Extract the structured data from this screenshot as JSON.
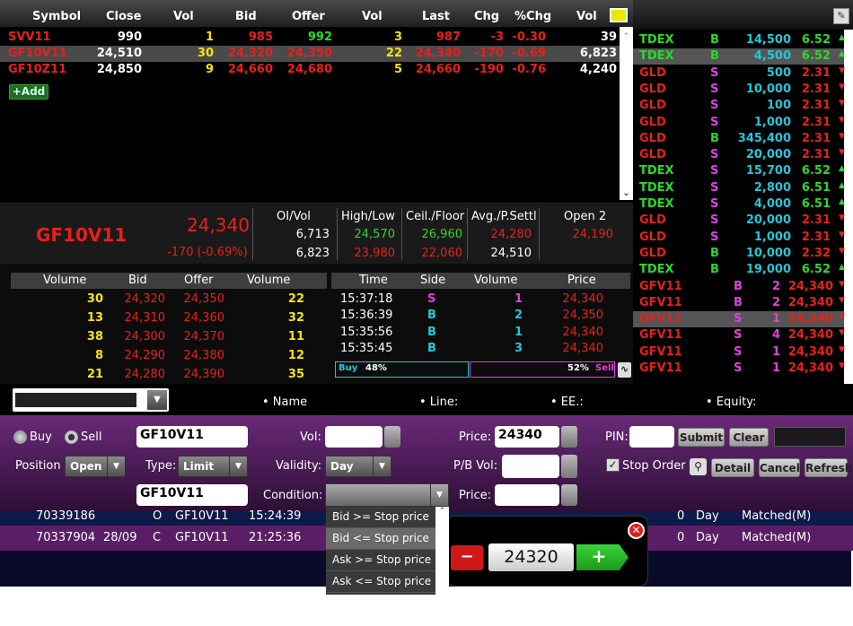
{
  "watchlist": {
    "headers": [
      "Symbol",
      "Close",
      "Vol",
      "Bid",
      "Offer",
      "Vol",
      "Last",
      "Chg",
      "%Chg",
      "Vol"
    ],
    "rows": [
      {
        "symbol": "SVV11",
        "close": "990",
        "bidvol": "1",
        "bid": "985",
        "offer": "992",
        "offervol": "3",
        "last": "987",
        "chg": "-3",
        "pchg": "-0.30",
        "vol": "39"
      },
      {
        "symbol": "GF10V11",
        "close": "24,510",
        "bidvol": "30",
        "bid": "24,320",
        "offer": "24,350",
        "offervol": "22",
        "last": "24,340",
        "chg": "-170",
        "pchg": "-0.69",
        "vol": "6,823"
      },
      {
        "symbol": "GF10Z11",
        "close": "24,850",
        "bidvol": "9",
        "bid": "24,660",
        "offer": "24,680",
        "offervol": "5",
        "last": "24,660",
        "chg": "-190",
        "pchg": "-0.76",
        "vol": "4,240"
      }
    ],
    "add_label": "+Add"
  },
  "ticker": [
    {
      "sym": "TDEX",
      "side": "B",
      "vol": "14,500",
      "price": "6.52",
      "dir": "up",
      "c": "g"
    },
    {
      "sym": "TDEX",
      "side": "B",
      "vol": "4,500",
      "price": "6.52",
      "dir": "up",
      "c": "g"
    },
    {
      "sym": "GLD",
      "side": "S",
      "vol": "500",
      "price": "2.31",
      "dir": "down",
      "c": "rd"
    },
    {
      "sym": "GLD",
      "side": "S",
      "vol": "10,000",
      "price": "2.31",
      "dir": "down",
      "c": "rd"
    },
    {
      "sym": "GLD",
      "side": "S",
      "vol": "100",
      "price": "2.31",
      "dir": "down",
      "c": "rd"
    },
    {
      "sym": "GLD",
      "side": "S",
      "vol": "1,000",
      "price": "2.31",
      "dir": "down",
      "c": "rd"
    },
    {
      "sym": "GLD",
      "side": "B",
      "vol": "345,400",
      "price": "2.31",
      "dir": "down",
      "c": "rd"
    },
    {
      "sym": "GLD",
      "side": "S",
      "vol": "20,000",
      "price": "2.31",
      "dir": "down",
      "c": "rd"
    },
    {
      "sym": "TDEX",
      "side": "S",
      "vol": "15,700",
      "price": "6.52",
      "dir": "up",
      "c": "g"
    },
    {
      "sym": "TDEX",
      "side": "S",
      "vol": "2,800",
      "price": "6.51",
      "dir": "up",
      "c": "g"
    },
    {
      "sym": "TDEX",
      "side": "S",
      "vol": "4,000",
      "price": "6.51",
      "dir": "up",
      "c": "g"
    },
    {
      "sym": "GLD",
      "side": "S",
      "vol": "20,000",
      "price": "2.31",
      "dir": "down",
      "c": "rd"
    },
    {
      "sym": "GLD",
      "side": "S",
      "vol": "1,000",
      "price": "2.31",
      "dir": "down",
      "c": "rd"
    },
    {
      "sym": "GLD",
      "side": "B",
      "vol": "10,000",
      "price": "2.32",
      "dir": "down",
      "c": "rd"
    },
    {
      "sym": "TDEX",
      "side": "B",
      "vol": "19,000",
      "price": "6.52",
      "dir": "up",
      "c": "g"
    },
    {
      "sym": "GFV11",
      "side": "B",
      "vol": "2",
      "price": "24,340",
      "dir": "down",
      "c": "rd"
    },
    {
      "sym": "GFV11",
      "side": "B",
      "vol": "2",
      "price": "24,340",
      "dir": "down",
      "c": "rd"
    },
    {
      "sym": "GFV11",
      "side": "S",
      "vol": "1",
      "price": "24,340",
      "dir": "down",
      "c": "rd"
    },
    {
      "sym": "GFV11",
      "side": "S",
      "vol": "4",
      "price": "24,340",
      "dir": "down",
      "c": "rd"
    },
    {
      "sym": "GFV11",
      "side": "S",
      "vol": "1",
      "price": "24,340",
      "dir": "down",
      "c": "rd"
    },
    {
      "sym": "GFV11",
      "side": "S",
      "vol": "1",
      "price": "24,340",
      "dir": "down",
      "c": "rd"
    }
  ],
  "quote": {
    "symbol": "GF10V11",
    "last": "24,340",
    "change": "-170 (-0.69%)",
    "oivol_label": "OI/Vol",
    "oi": "6,713",
    "vol": "6,823",
    "hl_label": "High/Low",
    "high": "24,570",
    "low": "23,980",
    "cf_label": "Ceil./Floor",
    "ceil": "26,960",
    "floor": "22,060",
    "avg_label": "Avg./P.Settl",
    "avg": "24,280",
    "settl": "24,510",
    "open2_label": "Open 2",
    "open2": "24,190"
  },
  "depth": {
    "headers": [
      "Volume",
      "Bid",
      "Offer",
      "Volume"
    ],
    "rows": [
      {
        "bv": "30",
        "bid": "24,320",
        "offer": "24,350",
        "ov": "22"
      },
      {
        "bv": "13",
        "bid": "24,310",
        "offer": "24,360",
        "ov": "32"
      },
      {
        "bv": "38",
        "bid": "24,300",
        "offer": "24,370",
        "ov": "11"
      },
      {
        "bv": "8",
        "bid": "24,290",
        "offer": "24,380",
        "ov": "12"
      },
      {
        "bv": "21",
        "bid": "24,280",
        "offer": "24,390",
        "ov": "35"
      }
    ]
  },
  "trades": {
    "headers": [
      "Time",
      "Side",
      "Volume",
      "Price"
    ],
    "rows": [
      {
        "time": "15:37:18",
        "side": "S",
        "vol": "1",
        "price": "24,340"
      },
      {
        "time": "15:36:39",
        "side": "B",
        "vol": "2",
        "price": "24,350"
      },
      {
        "time": "15:35:56",
        "side": "B",
        "vol": "1",
        "price": "24,340"
      },
      {
        "time": "15:35:45",
        "side": "B",
        "vol": "3",
        "price": "24,340"
      }
    ],
    "buy_label": "Buy",
    "buy_pct": "48%",
    "sell_pct": "52%",
    "sell_label": "Sell",
    "buy_ratio": 0.48
  },
  "account": {
    "name_label": "• Name",
    "line_label": "• Line:",
    "ee_label": "• EE.:",
    "equity_label": "• Equity:"
  },
  "order": {
    "buy_label": "Buy",
    "sell_label": "Sell",
    "symbol": "GF10V11",
    "vol_label": "Vol:",
    "vol_value": "",
    "price_label": "Price:",
    "price_value": "24340",
    "pin_label": "PIN:",
    "submit": "Submit",
    "clear": "Clear",
    "position_label": "Position",
    "position_value": "Open",
    "type_label": "Type:",
    "type_value": "Limit",
    "validity_label": "Validity:",
    "validity_value": "Day",
    "pbvol_label": "P/B Vol:",
    "stop_label": "Stop Order",
    "detail": "Detail",
    "cancel": "Cancel",
    "refresh": "Refresh",
    "stop_symbol": "GF10V11",
    "condition_label": "Condition:",
    "price2_label": "Price:"
  },
  "condition_menu": [
    "Bid >= Stop price",
    "Bid <= Stop price",
    "Ask >= Stop price",
    "Ask <= Stop price"
  ],
  "stepper": {
    "value": "24320",
    "minus": "−",
    "plus": "+"
  },
  "orders_list": [
    {
      "id": "70339186",
      "date": "",
      "type": "O",
      "sym": "GF10V11",
      "time": "15:24:39",
      "val": "0",
      "validity": "Day",
      "status": "Matched(M)"
    },
    {
      "id": "70337904",
      "date": "28/09",
      "type": "C",
      "sym": "GF10V11",
      "time": "21:25:36",
      "val": "0",
      "validity": "Day",
      "status": "Matched(M)"
    }
  ]
}
